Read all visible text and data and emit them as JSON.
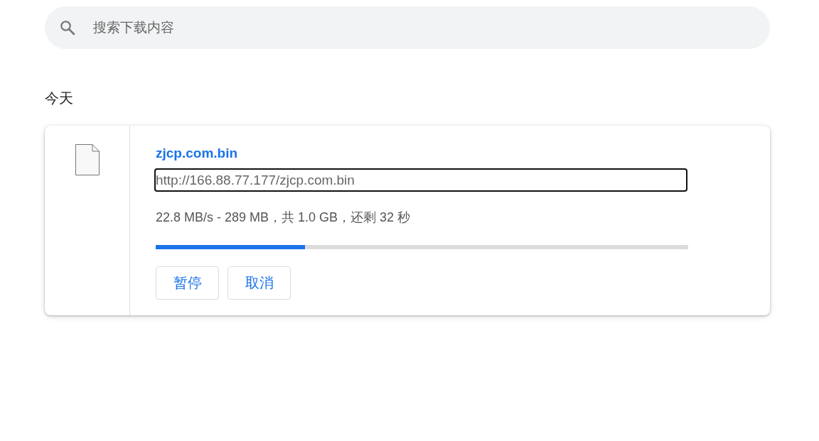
{
  "search": {
    "placeholder": "搜索下载内容"
  },
  "section_title": "今天",
  "downloads": [
    {
      "file_name": "zjcp.com.bin",
      "url": "http://166.88.77.177/zjcp.com.bin",
      "url_focused": true,
      "status": "22.8 MB/s - 289 MB，共 1.0 GB，还剩 32 秒",
      "level": 0.28,
      "buttons": [
        {
          "label": "暂停"
        },
        {
          "label": "取消"
        }
      ]
    }
  ]
}
